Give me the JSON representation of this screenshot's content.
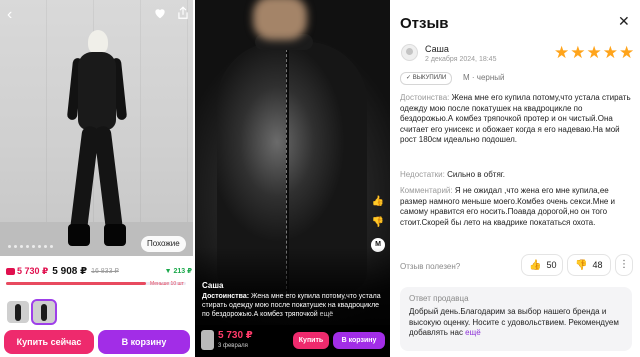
{
  "product": {
    "back_icon": "chevron-left-icon",
    "heart_icon": "heart-icon",
    "share_icon": "share-icon",
    "similar_label": "Похожие",
    "price_wallet": "5 730 ₽",
    "price_main": "5 908 ₽",
    "price_old": "16 833 ₽",
    "discount": "▼ 213 ₽",
    "less_label": "Меньше 10 шт",
    "stock_fraction": 0.78,
    "buy_now_label": "Купить сейчас",
    "cart_label": "В корзину"
  },
  "video": {
    "author": "Саша",
    "text_label": "Достоинства:",
    "text_body": " Жена мне его купила потому,что устала стирать одежду мою после покатушек на квадроцикле по бездорожью.А комбез тряпочкой",
    "more_label": " ещё",
    "price": "5 730 ₽",
    "date": "3 февраля",
    "buy_label": "Купить",
    "cart_label": "В корзину",
    "side_m": "М"
  },
  "review": {
    "title": "Отзыв",
    "close_icon": "close-icon",
    "author": "Саша",
    "date": "2 декабря 2024, 18:45",
    "rating": 5,
    "stars": "★★★★★",
    "badge": "✓ ВЫКУПИЛИ",
    "variant": "M · черный",
    "advantages_label": "Достоинства:",
    "advantages": " Жена мне его купила потому,что устала стирать одежду мою после покатушек на квадроцикле по бездорожью.А комбез тряпочкой протер и он чистый.Она считает его унисекс и обожает когда я его надеваю.На мой рост 180см идеально подошел.",
    "disadvantages_label": "Недостатки:",
    "disadvantages": " Сильно в обтяг.",
    "comment_label": "Комментарий:",
    "comment": " Я не ожидал ,что жена его мне купила,ее размер намного меньше моего.Комбез очень секси.Мне и самому нравится его носить.Поавда дорогой,но он того стоит.Скорей бы лето на квадрике покататься охота.",
    "helpful_label": "Отзыв полезен?",
    "likes": "50",
    "dislikes": "48",
    "more_icon": "⋮",
    "answer_title": "Ответ продавца",
    "answer_text": "Добрый день.Благодарим за выбор нашего бренда и высокую оценку.  Носите с удовольствием. Рекомендуем добавлять нас",
    "answer_more": " ещё"
  }
}
